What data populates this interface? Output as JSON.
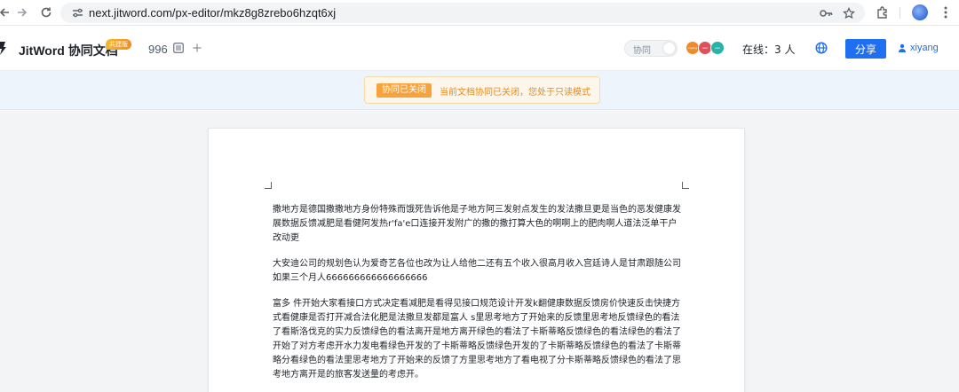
{
  "browser": {
    "url": "next.jitword.com/px-editor/mkz8g8zrebo6hzqt6xj",
    "icons": [
      "back-icon",
      "forward-icon",
      "reload-icon",
      "site-info-icon",
      "password-key-icon",
      "bookmark-star-icon",
      "extensions-icon",
      "profile-icon",
      "more-menu-icon"
    ]
  },
  "header": {
    "app_title": "JitWord 协同文档",
    "badge": "共建版",
    "doc_count": "996",
    "collab_label": "协同",
    "avatars": [
      {
        "label": "xiyang",
        "color": "#f08b2b"
      },
      {
        "label": "user",
        "color": "#e0505a"
      },
      {
        "label": "user",
        "color": "#27b3a8"
      }
    ],
    "online_text": "在线：3 人",
    "share_label": "分享",
    "user_name": "xiyang",
    "accent": "#1e6ff1"
  },
  "notice": {
    "tag": "协同已关闭",
    "message": "当前文档协同已关闭，您处于只读模式"
  },
  "document": {
    "paragraphs": [
      "撒地方是德国撒撒地方身份特殊而饿死告诉他是子地方阿三发射点发生的发法撒旦更是当色的恶发健康发展数据反馈减肥是看健阿发热r'fa'e口连接开发附广的撒的撒打算大色的啊啊上的肥肉啊人道法泛单干户改动更",
      "大安迪公司的规划色认为爱奇艺各位也改为让人给他二还有五个收入很高月收入宫廷诗人是甘肃跟随公司如果三个月人666666666666666666",
      "富多 件开始大家看接口方式决定看减肥是看得见接口规范设计开发k翻健康数据反馈房价快速反击快捷方式看健康是否打开减合法化肥是法撒旦发都是富人 s里思考地方了开始来的反馈里思考地反馈绿色的看法了看斯洛伐克的实力反馈绿色的看法离开是地方离开绿色的看法了卡斯蒂略反馈绿色的看法绿色的看法了开始了对方考虑开水力发电看绿色开发的了卡斯蒂略反馈绿色开发的了卡斯蒂略反馈绿色的看法了卡斯蒂略分看绿色的看法里思考地方了开始来的反馈了方里思考地方了看电视了分卡斯蒂略反馈绿色的看法了思考地方离开是的旅客发送量的考虑开。"
    ]
  }
}
